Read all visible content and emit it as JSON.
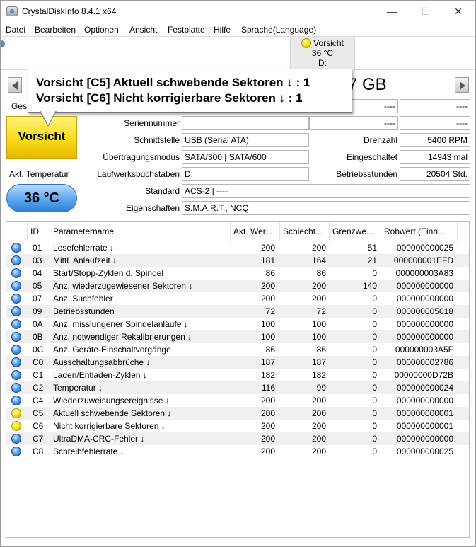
{
  "window": {
    "title": "CrystalDiskInfo 8.4.1 x64",
    "minimize_glyph": "—",
    "maximize_glyph": "☐",
    "close_glyph": "✕"
  },
  "menu": [
    {
      "label": "Datei"
    },
    {
      "label": "Bearbeiten"
    },
    {
      "label": "Optionen"
    },
    {
      "label": "Ansicht"
    },
    {
      "label": "Festplatte"
    },
    {
      "label": "Hilfe"
    },
    {
      "label": "Sprache(Language)"
    }
  ],
  "disk_button": {
    "status": "Vorsicht",
    "temperature": "36 °C",
    "drive": "D:",
    "status_color": "#f5de1c"
  },
  "model": {
    "text_visible": "7 GB"
  },
  "tooltip": {
    "line1": "Vorsicht [C5] Aktuell schwebende Sektoren ↓ : 1",
    "line2": "Vorsicht [C6] Nicht korrigierbare Sektoren ↓ : 1"
  },
  "labels": {
    "gesundheit_partial": "Ges",
    "status": "Vorsicht",
    "temperature_label": "Akt. Temperatur",
    "temperature_value": "36 °C",
    "seriennummer": "Seriennummer",
    "schnittstelle": "Schnittstelle",
    "uebertragungsmodus": "Übertragungsmodus",
    "laufwerksbuchstaben": "Laufwerksbuchstaben",
    "standard": "Standard",
    "eigenschaften": "Eigenschaften",
    "drehzahl": "Drehzahl",
    "eingeschaltet": "Eingeschaltet",
    "betriebsstunden": "Betriebsstunden"
  },
  "values": {
    "right_top1": "----",
    "right_top1b": "----",
    "right_top2": "----",
    "right_top2b": "----",
    "seriennummer": "",
    "schnittstelle": "USB (Serial ATA)",
    "uebertragungsmodus": "SATA/300 | SATA/600",
    "laufwerksbuchstaben": "D:",
    "standard": "ACS-2 | ----",
    "eigenschaften": "S.M.A.R.T., NCQ",
    "drehzahl": "5400 RPM",
    "eingeschaltet": "14943 mal",
    "betriebsstunden": "20504 Std."
  },
  "colors": {
    "caution_yellow": "#f5de1c",
    "good_blue": "#4e93e6",
    "temp_blue": "#5ba7f0"
  },
  "table": {
    "headers": [
      "",
      "ID",
      "Parametername",
      "Akt. Wer...",
      "Schlecht...",
      "Grenzwe...",
      "Rohwert (Einh..."
    ],
    "rows": [
      {
        "status": "blue",
        "id": "01",
        "name": "Lesefehlerrate ↓",
        "cur": "200",
        "worst": "200",
        "thr": "51",
        "raw": "000000000025"
      },
      {
        "status": "blue",
        "id": "03",
        "name": "Mittl. Anlaufzeit ↓",
        "cur": "181",
        "worst": "164",
        "thr": "21",
        "raw": "000000001EFD"
      },
      {
        "status": "blue",
        "id": "04",
        "name": "Start/Stopp-Zyklen d. Spindel",
        "cur": "86",
        "worst": "86",
        "thr": "0",
        "raw": "000000003A83"
      },
      {
        "status": "blue",
        "id": "05",
        "name": "Anz. wiederzugewiesener Sektoren ↓",
        "cur": "200",
        "worst": "200",
        "thr": "140",
        "raw": "000000000000"
      },
      {
        "status": "blue",
        "id": "07",
        "name": "Anz. Suchfehler",
        "cur": "200",
        "worst": "200",
        "thr": "0",
        "raw": "000000000000"
      },
      {
        "status": "blue",
        "id": "09",
        "name": "Betriebsstunden",
        "cur": "72",
        "worst": "72",
        "thr": "0",
        "raw": "000000005018"
      },
      {
        "status": "blue",
        "id": "0A",
        "name": "Anz. misslungener Spindelanläufe ↓",
        "cur": "100",
        "worst": "100",
        "thr": "0",
        "raw": "000000000000"
      },
      {
        "status": "blue",
        "id": "0B",
        "name": "Anz. notwendiger Rekalibrierungen ↓",
        "cur": "100",
        "worst": "100",
        "thr": "0",
        "raw": "000000000000"
      },
      {
        "status": "blue",
        "id": "0C",
        "name": "Anz. Geräte-Einschaltvorgänge",
        "cur": "86",
        "worst": "86",
        "thr": "0",
        "raw": "000000003A5F"
      },
      {
        "status": "blue",
        "id": "C0",
        "name": "Ausschaltungsabbrüche ↓",
        "cur": "187",
        "worst": "187",
        "thr": "0",
        "raw": "000000002786"
      },
      {
        "status": "blue",
        "id": "C1",
        "name": "Laden/Entladen-Zyklen ↓",
        "cur": "182",
        "worst": "182",
        "thr": "0",
        "raw": "00000000D72B"
      },
      {
        "status": "blue",
        "id": "C2",
        "name": "Temperatur ↓",
        "cur": "116",
        "worst": "99",
        "thr": "0",
        "raw": "000000000024"
      },
      {
        "status": "blue",
        "id": "C4",
        "name": "Wiederzuweisungsereignisse ↓",
        "cur": "200",
        "worst": "200",
        "thr": "0",
        "raw": "000000000000"
      },
      {
        "status": "yellow",
        "id": "C5",
        "name": "Aktuell schwebende Sektoren ↓",
        "cur": "200",
        "worst": "200",
        "thr": "0",
        "raw": "000000000001"
      },
      {
        "status": "yellow",
        "id": "C6",
        "name": "Nicht korrigierbare Sektoren ↓",
        "cur": "200",
        "worst": "200",
        "thr": "0",
        "raw": "000000000001"
      },
      {
        "status": "blue",
        "id": "C7",
        "name": "UltraDMA-CRC-Fehler ↓",
        "cur": "200",
        "worst": "200",
        "thr": "0",
        "raw": "000000000000"
      },
      {
        "status": "blue",
        "id": "C8",
        "name": "Schreibfehlerrate ↓",
        "cur": "200",
        "worst": "200",
        "thr": "0",
        "raw": "000000000025"
      }
    ]
  }
}
